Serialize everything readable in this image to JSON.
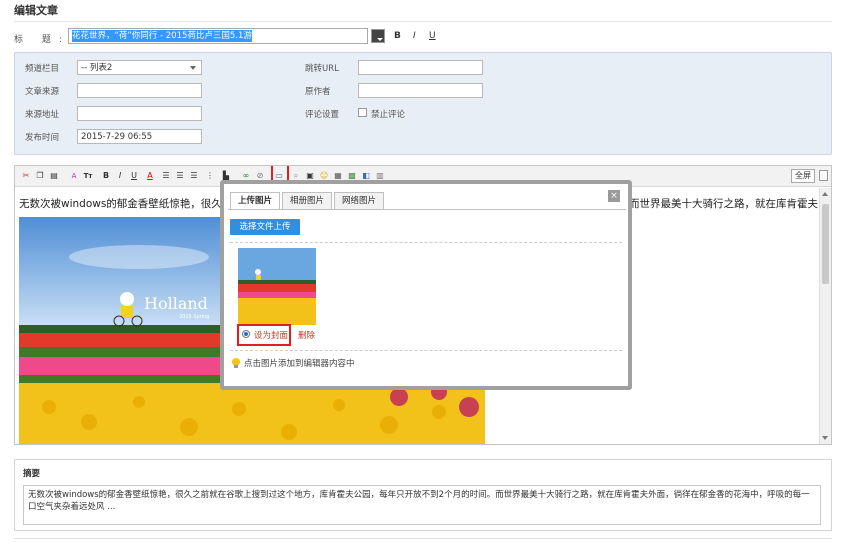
{
  "page": {
    "title": "编辑文章"
  },
  "title_row": {
    "label": "标 题:",
    "value": "花花世界，“荷”你同行 - 2015荷比卢三国5.1游",
    "bold": "B",
    "italic": "I",
    "underline": "U"
  },
  "meta": {
    "channel_label": "频道栏目",
    "channel_value": "-- 列表2",
    "source_label": "文章来源",
    "source_value": "",
    "source_url_label": "来源地址",
    "source_url_value": "",
    "publish_time_label": "发布时间",
    "publish_time_value": "2015-7-29 06:55",
    "redirect_label": "跳转URL",
    "redirect_value": "",
    "author_label": "原作者",
    "author_value": "",
    "comment_label": "评论设置",
    "disable_comment_label": "禁止评论",
    "disable_comment_checked": false
  },
  "editor": {
    "toolbar": {
      "fullscreen_label": "全屏",
      "text_color_glyph": "A",
      "font_size_glyph": "Tт",
      "bold": "B",
      "italic": "I",
      "underline": "U",
      "text_color": "A"
    },
    "content_line1": "无数次被windows的郁金香壁纸惊艳，很久",
    "content_line1_tail": "而世界最美十大骑行之路，就在库肯霍夫",
    "content_line2": "外面，徜徉在郁金香的花海中，呼吸的每一",
    "photo": {
      "caption": "Holland",
      "caption_sub": "2015 Spring"
    }
  },
  "image_dialog": {
    "tabs": [
      "上传图片",
      "相册图片",
      "网络图片"
    ],
    "active_tab": 0,
    "close": "×",
    "upload_button": "选择文件上传",
    "set_cover": "设为封面",
    "delete": "删除",
    "tip": "点击图片添加到编辑器内容中"
  },
  "summary": {
    "label": "摘要",
    "text": "无数次被windows的郁金香壁纸惊艳，很久之前就在谷歌上搜到过这个地方，库肯霍夫公园，每年只开放不到2个月的时间。而世界最美十大骑行之路，就在库肯霍夫外面，徜徉在郁金香的花海中，呼吸的每一口空气夹杂着远处风 ..."
  },
  "colors": {
    "accent": "#2f8fe0",
    "highlight_red": "#e02020",
    "panel_bg": "#e8eef5",
    "link_red": "#c0392b"
  }
}
